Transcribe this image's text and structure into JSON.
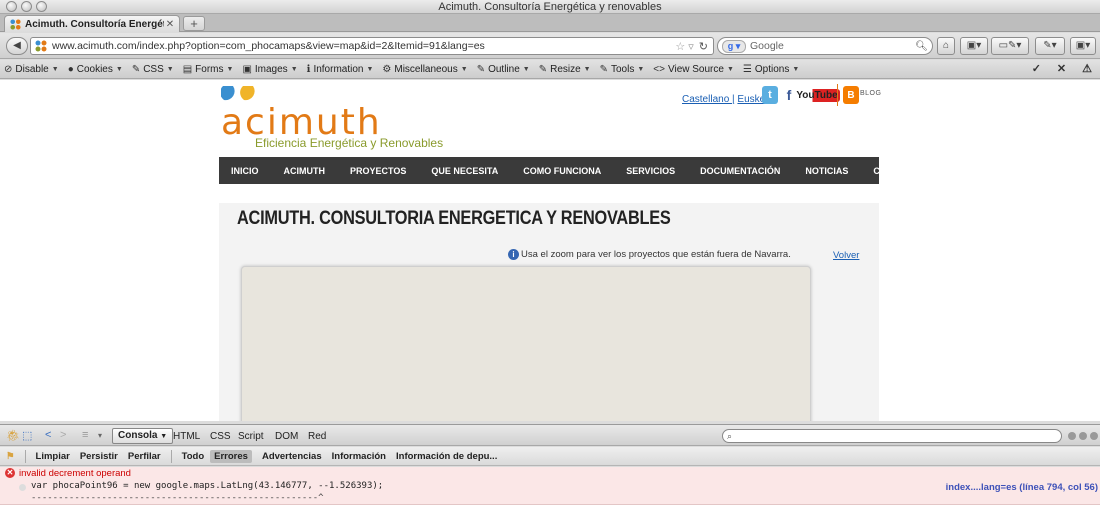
{
  "window": {
    "title": "Acimuth. Consultoría Energética y renovables"
  },
  "tabs": [
    {
      "label": "Acimuth. Consultoría Energética..."
    }
  ],
  "navbar": {
    "url": "www.acimuth.com/index.php?option=com_phocamaps&view=map&id=2&Itemid=91&lang=es",
    "search_placeholder": "Google",
    "search_engine_icon": "google-icon"
  },
  "devtoolbar": {
    "items": [
      {
        "label": "Disable",
        "icon": "⊘"
      },
      {
        "label": "Cookies",
        "icon": "●"
      },
      {
        "label": "CSS",
        "icon": "✎"
      },
      {
        "label": "Forms",
        "icon": "▤"
      },
      {
        "label": "Images",
        "icon": "▣"
      },
      {
        "label": "Information",
        "icon": "ℹ"
      },
      {
        "label": "Miscellaneous",
        "icon": "⚙"
      },
      {
        "label": "Outline",
        "icon": "✎"
      },
      {
        "label": "Resize",
        "icon": "✎"
      },
      {
        "label": "Tools",
        "icon": "✎"
      },
      {
        "label": "View Source",
        "icon": "<>"
      },
      {
        "label": "Options",
        "icon": "☰"
      }
    ]
  },
  "site": {
    "logo_word": "acimuth",
    "logo_tagline": "Eficiencia Energética y Renovables",
    "lang_castellano": "Castellano |",
    "lang_euskera": "Euskera",
    "youtube_label": "YouTube",
    "blog_label": "BLOG",
    "menu": [
      "INICIO",
      "ACIMUTH",
      "PROYECTOS",
      "QUE NECESITA",
      "COMO FUNCIONA",
      "SERVICIOS",
      "DOCUMENTACIÓN",
      "NOTICIAS",
      "CONTACTO"
    ],
    "page_title": "ACIMUTH. CONSULTORIA ENERGETICA Y RENOVABLES",
    "zoom_notice": "Usa el zoom para ver los proyectos que están fuera de Navarra.",
    "back_link": "Volver",
    "colors": {
      "brand_orange": "#e27a16",
      "brand_green": "#8a9b2c",
      "brand_blue": "#1a5fb4"
    }
  },
  "firebug": {
    "panel_select": "Consola",
    "tabs": [
      "HTML",
      "CSS",
      "Script",
      "DOM",
      "Red"
    ],
    "subtabs": [
      "Limpiar",
      "Persistir",
      "Perfilar",
      "Todo",
      "Errores",
      "Advertencias",
      "Información",
      "Información de depu..."
    ],
    "active_subtab": "Errores",
    "error": {
      "message": "invalid decrement operand",
      "code": "var phocaPoint96 = new google.maps.LatLng(43.146777, --1.526393);",
      "caret": "-----------------------------------------------------^",
      "location": "index....lang=es (línea 794, col 56)"
    }
  }
}
